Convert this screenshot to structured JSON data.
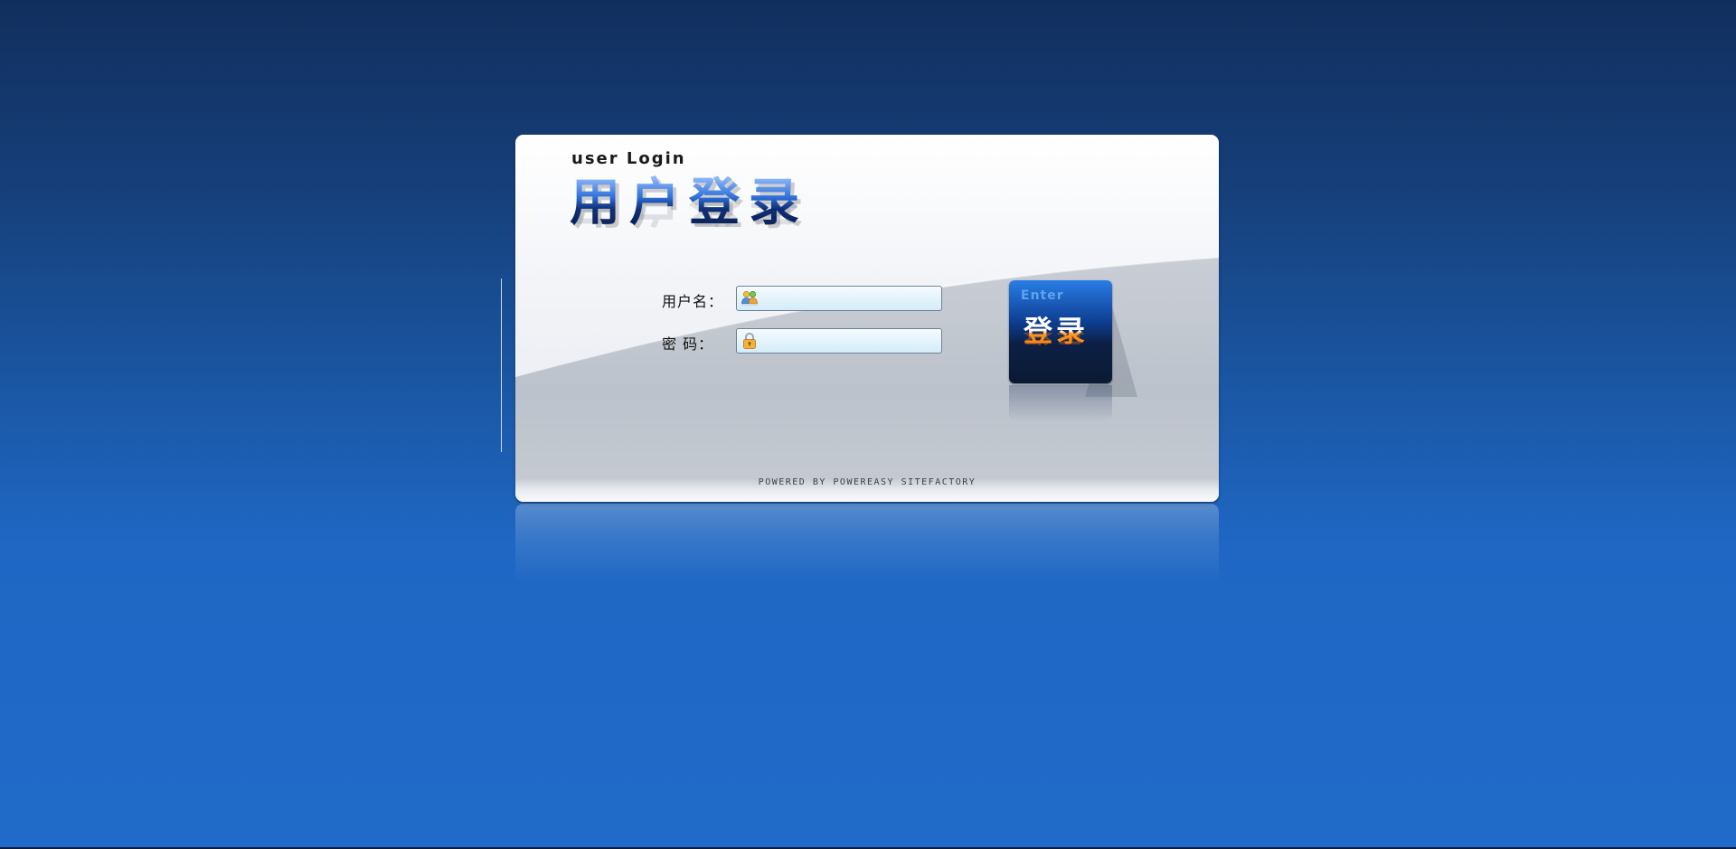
{
  "login": {
    "subtitle": "user Login",
    "title": "用户登录",
    "username_label": "用户名：",
    "username_value": "",
    "password_label": "密 码：",
    "password_value": "",
    "enter_word": "Enter",
    "enter_label": "登录",
    "powered_by": "POWERED BY POWEREASY SITEFACTORY"
  },
  "icons": {
    "username": "users-icon",
    "password": "lock-icon"
  },
  "colors": {
    "background_top": "#112f5e",
    "background_bottom": "#206ac9",
    "button_blue": "#0d3f93",
    "button_orange": "#ff7a00"
  }
}
